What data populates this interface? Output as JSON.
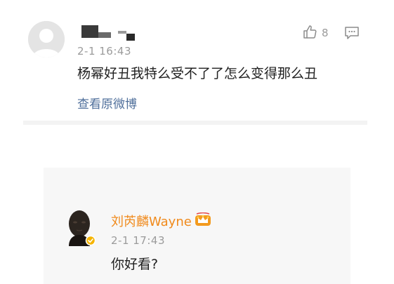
{
  "comment": {
    "author": "",
    "time": "2-1 16:43",
    "text": "杨幂好丑我特么受不了了怎么变得那么丑",
    "view_original_label": "查看原微博",
    "like_count": "8",
    "icons": {
      "avatar": "default-avatar-icon",
      "like": "thumbs-up-icon",
      "comment": "comment-icon"
    }
  },
  "reply": {
    "author": "刘芮麟Wayne",
    "time": "2-1 17:43",
    "text": "你好看?",
    "icons": {
      "verified": "verified-badge-icon",
      "member": "crown-badge-icon"
    }
  },
  "colors": {
    "link_blue": "#4f6f9b",
    "username_orange": "#f08a1c",
    "muted_gray": "#9b9b9b",
    "card_bg": "#f7f7f7"
  }
}
